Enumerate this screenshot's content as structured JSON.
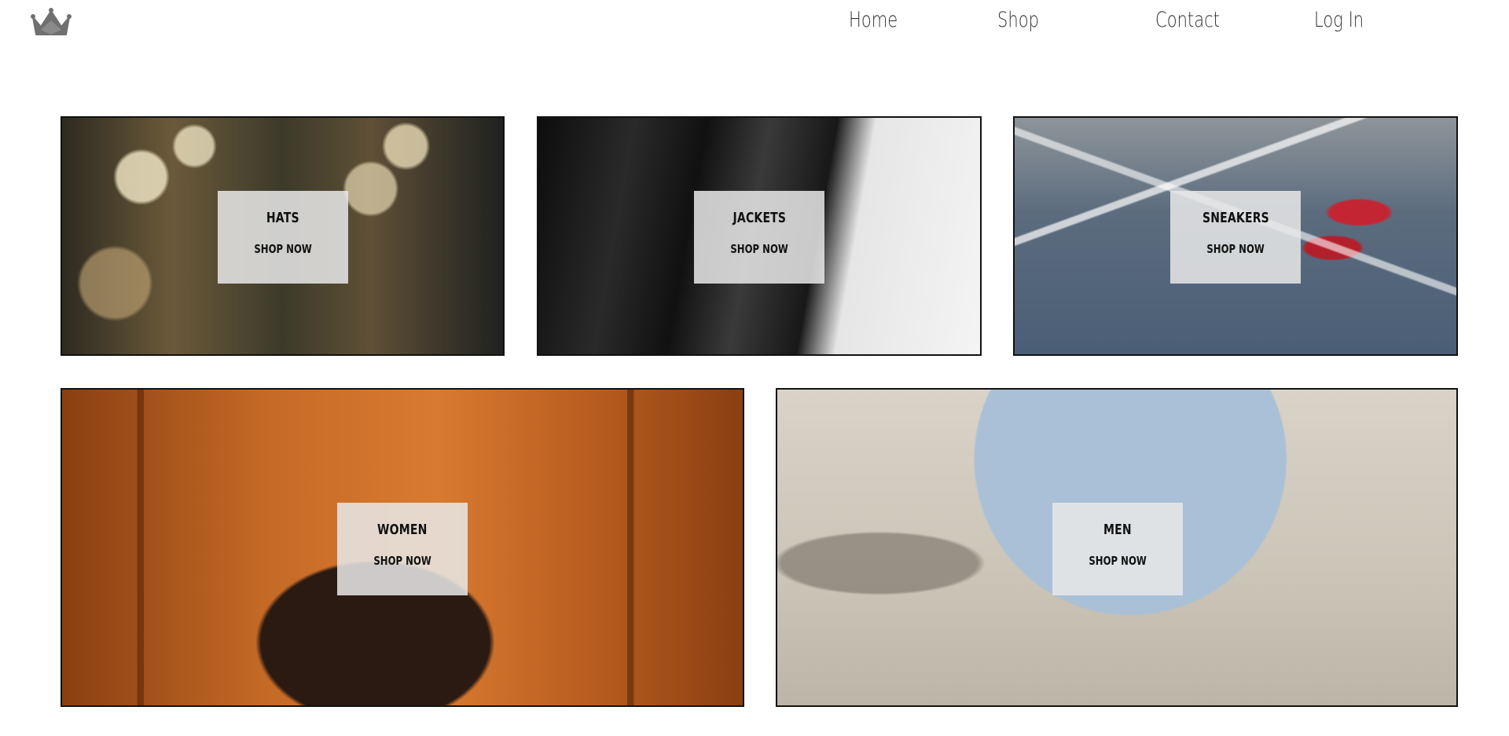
{
  "brand": {
    "logo_icon": "crown-icon"
  },
  "nav": {
    "items": [
      "Home",
      "Shop",
      "Contact",
      "Log In"
    ]
  },
  "categories": [
    {
      "title": "HATS",
      "cta": "SHOP NOW"
    },
    {
      "title": "JACKETS",
      "cta": "SHOP NOW"
    },
    {
      "title": "SNEAKERS",
      "cta": "SHOP NOW"
    },
    {
      "title": "WOMEN",
      "cta": "SHOP NOW"
    },
    {
      "title": "MEN",
      "cta": "SHOP NOW"
    }
  ],
  "colors": {
    "text": "#333333",
    "tile_border": "#111111",
    "card_bg": "#e8e8e8"
  }
}
